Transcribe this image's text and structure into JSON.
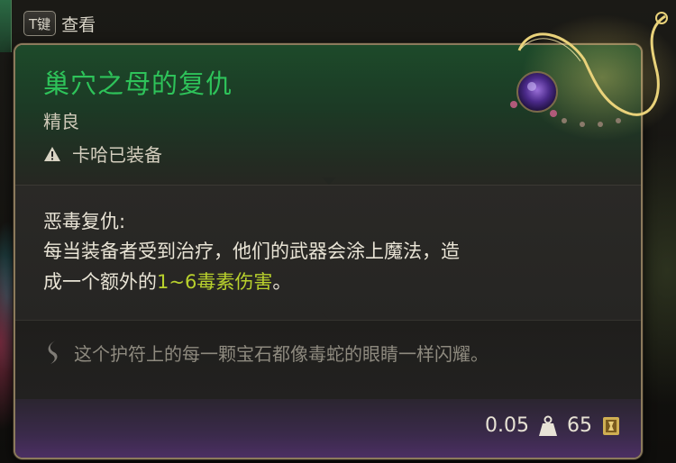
{
  "hint": {
    "key_label": "T键",
    "action_label": "查看"
  },
  "item": {
    "name": "巢穴之母的复仇",
    "rarity": "精良",
    "equipped_text": "卡哈已装备",
    "passive_name": "恶毒复仇:",
    "passive_desc_part1": "每当装备者受到治疗，他们的武器会涂上魔法，造成一个额外的",
    "passive_damage": "1~6毒素伤害",
    "passive_desc_part2": "。",
    "flavor_text": "这个护符上的每一颗宝石都像毒蛇的眼睛一样闪耀。",
    "weight": "0.05",
    "value": "65"
  },
  "colors": {
    "title_green": "#2ec35a",
    "damage_yellow_green": "#b9d12d",
    "frame_gold": "#8b7a5c",
    "footer_purple": "#4b2f63"
  },
  "icons": {
    "warning": "warning-icon",
    "flavor": "scroll-icon",
    "weight": "weight-icon",
    "gold": "gold-icon"
  }
}
